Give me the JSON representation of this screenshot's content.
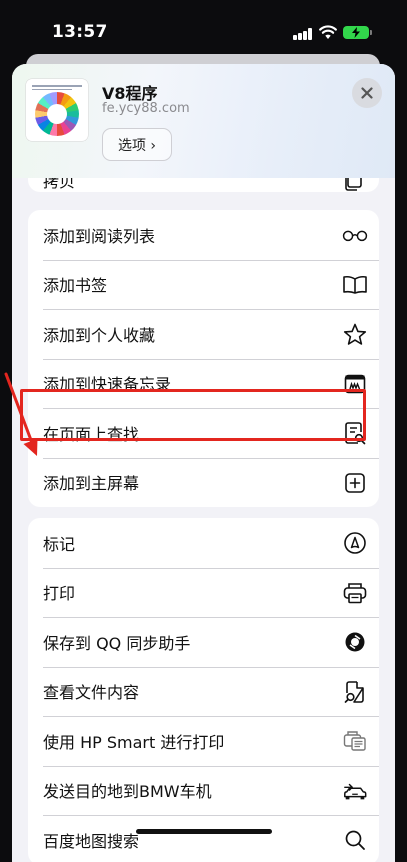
{
  "status": {
    "time": "13:57"
  },
  "site": {
    "title": "V8程序",
    "url": "fe.ycy88.com",
    "options_label": "选项 ›"
  },
  "partial_row": {
    "label": "拷贝"
  },
  "group1": [
    {
      "label": "添加到阅读列表",
      "icon": "glasses-icon"
    },
    {
      "label": "添加书签",
      "icon": "book-icon"
    },
    {
      "label": "添加到个人收藏",
      "icon": "star-icon"
    },
    {
      "label": "添加到快速备忘录",
      "icon": "quick-note-icon"
    },
    {
      "label": "在页面上查找",
      "icon": "find-in-page-icon"
    },
    {
      "label": "添加到主屏幕",
      "icon": "add-square-icon",
      "highlighted": true
    }
  ],
  "group2": [
    {
      "label": "标记",
      "icon": "markup-icon"
    },
    {
      "label": "打印",
      "icon": "printer-icon"
    },
    {
      "label": "保存到 QQ 同步助手",
      "icon": "qq-sync-icon"
    },
    {
      "label": "查看文件内容",
      "icon": "view-file-icon"
    },
    {
      "label": "使用 HP Smart 进行打印",
      "icon": "hp-print-icon"
    },
    {
      "label": "发送目的地到BMW车机",
      "icon": "car-icon"
    },
    {
      "label": "百度地图搜索",
      "icon": "search-icon"
    }
  ],
  "colors": {
    "highlight": "#e3261f",
    "accent_battery": "#32d74b"
  }
}
